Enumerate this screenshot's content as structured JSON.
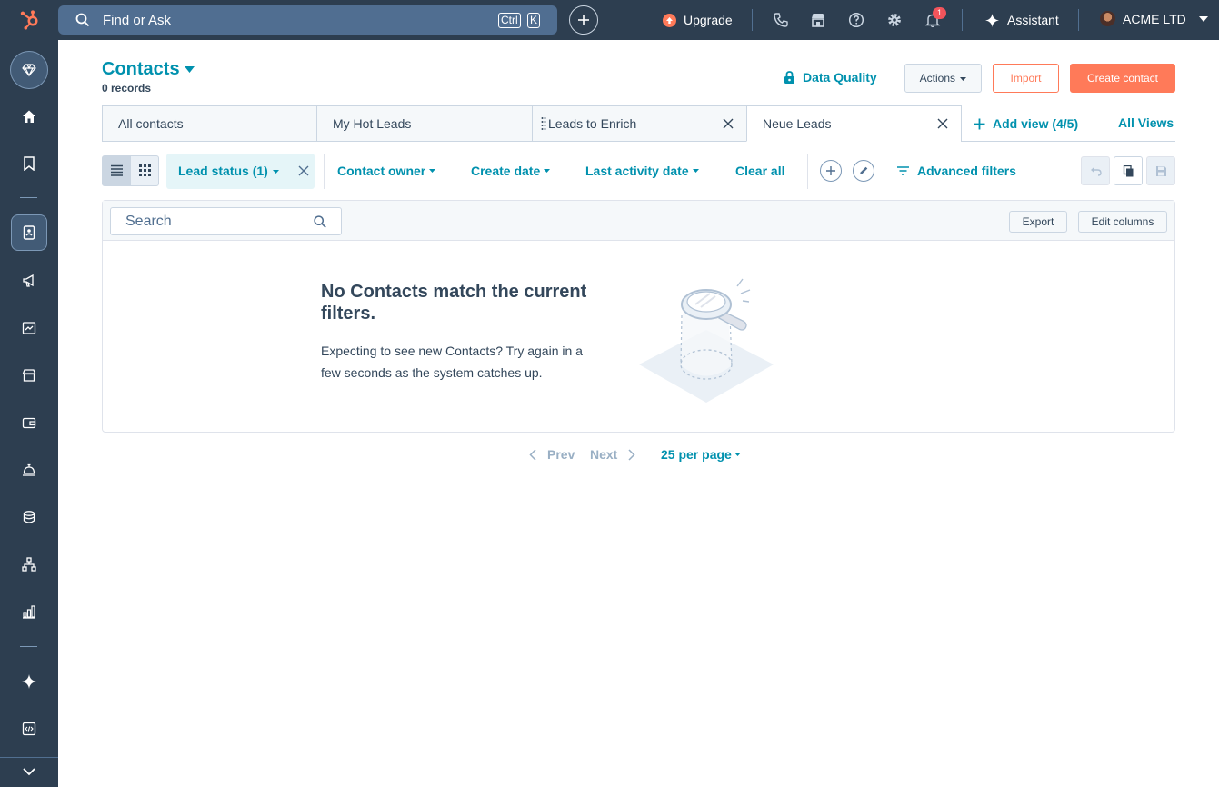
{
  "topbar": {
    "search_placeholder": "Find or Ask",
    "kbd_ctrl": "Ctrl",
    "kbd_k": "K",
    "upgrade_label": "Upgrade",
    "notification_count": "1",
    "assistant_label": "Assistant",
    "account_name": "ACME LTD"
  },
  "page": {
    "title": "Contacts",
    "records": "0 records",
    "data_quality_label": "Data Quality",
    "actions_label": "Actions",
    "import_label": "Import",
    "create_label": "Create contact"
  },
  "tabs": [
    {
      "label": "All contacts"
    },
    {
      "label": "My Hot Leads"
    },
    {
      "label": "Leads to Enrich"
    },
    {
      "label": "Neue Leads"
    }
  ],
  "add_view_label": "Add view (4/5)",
  "all_views_label": "All Views",
  "filters": {
    "lead_status": "Lead status (1)",
    "contact_owner": "Contact owner",
    "create_date": "Create date",
    "last_activity": "Last activity date",
    "clear_all": "Clear all",
    "advanced": "Advanced filters"
  },
  "table": {
    "search_placeholder": "Search",
    "export_label": "Export",
    "edit_columns_label": "Edit columns",
    "empty_title": "No Contacts match the current filters.",
    "empty_text": "Expecting to see new Contacts? Try again in a few seconds as the system catches up."
  },
  "pagination": {
    "prev": "Prev",
    "next": "Next",
    "per_page": "25 per page"
  },
  "colors": {
    "nav_bg": "#2d3e50",
    "accent": "#0091ae",
    "cta": "#ff7a59"
  }
}
